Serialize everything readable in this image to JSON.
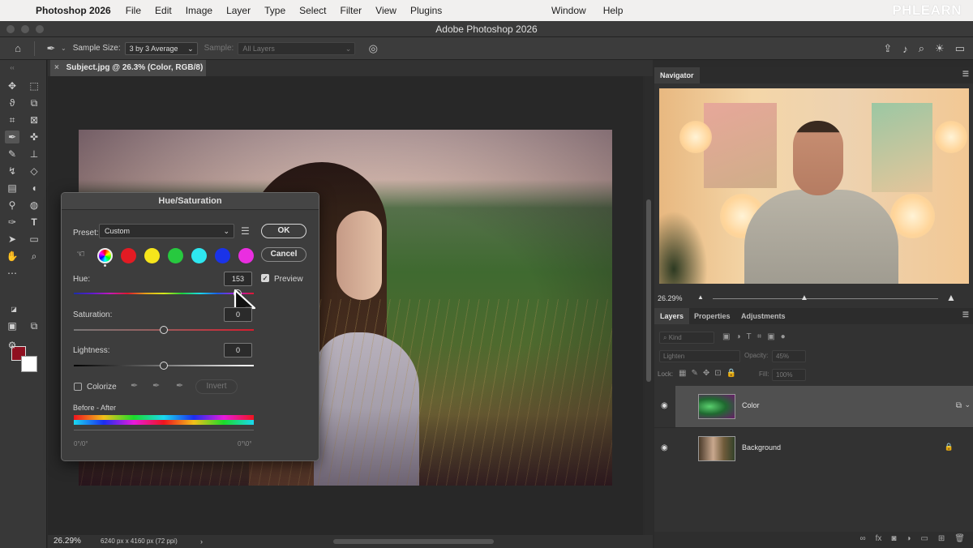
{
  "menubar": {
    "app_name": "Photoshop 2026",
    "items": [
      "File",
      "Edit",
      "Image",
      "Layer",
      "Type",
      "Select",
      "Filter",
      "View",
      "Plugins"
    ],
    "right_items": [
      "Window",
      "Help"
    ],
    "watermark": "PHLEARN"
  },
  "window": {
    "title": "Adobe Photoshop 2026"
  },
  "options": {
    "sample_size_label": "Sample Size:",
    "sample_size_value": "3 by 3 Average",
    "sample_label": "Sample:",
    "sample_value": "All Layers"
  },
  "document": {
    "tab_label": "Subject.jpg @ 26.3% (Color, RGB/8) *",
    "zoom": "26.29%",
    "dimensions": "6240 px x 4160 px (72 ppi)"
  },
  "dialog": {
    "title": "Hue/Saturation",
    "preset_label": "Preset:",
    "preset_value": "Custom",
    "ok_label": "OK",
    "cancel_label": "Cancel",
    "hue_label": "Hue:",
    "hue_value": "153",
    "preview_label": "Preview",
    "preview_checked": true,
    "saturation_label": "Saturation:",
    "saturation_value": "0",
    "lightness_label": "Lightness:",
    "lightness_value": "0",
    "colorize_label": "Colorize",
    "invert_label": "Invert",
    "before_after_label": "Before - After",
    "range_left": "0°/0°",
    "range_right": "0°\\0°",
    "hue_level": 0.911,
    "saturation_level": 0.5,
    "lightness_level": 0.5,
    "channel_colors": [
      "#e31b23",
      "#f6e51b",
      "#27c93f",
      "#2ee7f0",
      "#1a33e8",
      "#ea2ee0"
    ]
  },
  "navigator": {
    "tab_label": "Navigator",
    "zoom": "26.29%"
  },
  "layers_panel": {
    "tabs": [
      "Layers",
      "Properties",
      "Adjustments"
    ],
    "kind_label": "Kind",
    "blend_mode": "Lighten",
    "opacity_label": "Opacity:",
    "opacity_value": "45%",
    "lock_label": "Lock:",
    "fill_label": "Fill:",
    "fill_value": "100%",
    "layers": [
      {
        "name": "Color"
      },
      {
        "name": "Background"
      }
    ]
  },
  "colors": {
    "foreground": "#8f1020",
    "background": "#ffffff"
  }
}
